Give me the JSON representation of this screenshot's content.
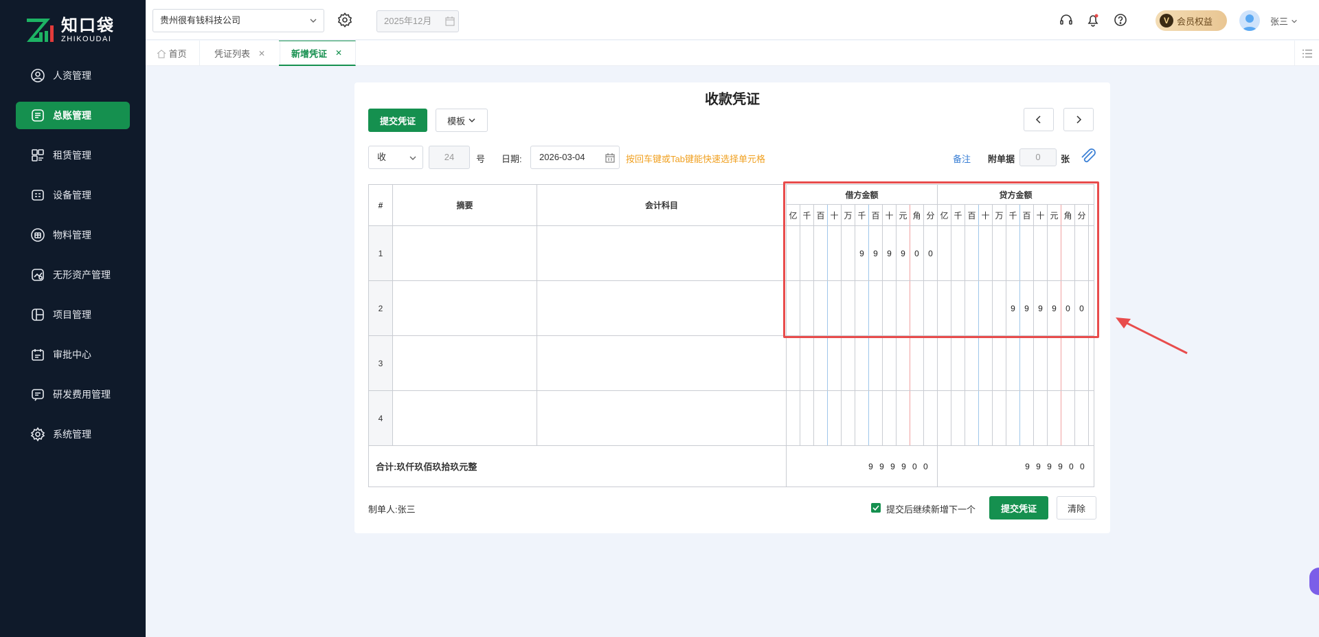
{
  "logo": {
    "cn": "知口袋",
    "en": "ZHIKOUDAI"
  },
  "sidebar": {
    "items": [
      {
        "label": "人资管理",
        "icon": "user-circle-icon"
      },
      {
        "label": "总账管理",
        "icon": "ledger-icon",
        "active": true
      },
      {
        "label": "租赁管理",
        "icon": "lease-icon"
      },
      {
        "label": "设备管理",
        "icon": "device-icon"
      },
      {
        "label": "物料管理",
        "icon": "material-icon"
      },
      {
        "label": "无形资产管理",
        "icon": "asset-icon"
      },
      {
        "label": "项目管理",
        "icon": "project-icon"
      },
      {
        "label": "审批中心",
        "icon": "approval-icon"
      },
      {
        "label": "研发费用管理",
        "icon": "rd-icon"
      },
      {
        "label": "系统管理",
        "icon": "settings-icon"
      }
    ]
  },
  "header": {
    "company": "贵州很有钱科技公司",
    "period": "2025年12月",
    "vip": "会员权益",
    "vip_badge": "V",
    "user": "张三"
  },
  "tabs": [
    {
      "label": "首页"
    },
    {
      "label": "凭证列表"
    },
    {
      "label": "新增凭证"
    }
  ],
  "voucher": {
    "title": "收款凭证",
    "submit": "提交凭证",
    "template": "模板",
    "type": "收",
    "number": "24",
    "number_suffix": "号",
    "date_label": "日期:",
    "date": "2026-03-04",
    "hint": "按回车键或Tab键能快速选择单元格",
    "remark": "备注",
    "attach_label": "附单据",
    "attach_count": "0",
    "attach_unit": "张",
    "headers": {
      "index": "#",
      "summary": "摘要",
      "subject": "会计科目",
      "debit": "借方金额",
      "credit": "贷方金额"
    },
    "digit_units": [
      "亿",
      "千",
      "百",
      "十",
      "万",
      "千",
      "百",
      "十",
      "元",
      "角",
      "分"
    ],
    "rows": [
      {
        "no": "1",
        "debit": "999900",
        "credit": ""
      },
      {
        "no": "2",
        "debit": "",
        "credit": "999900"
      },
      {
        "no": "3",
        "debit": "",
        "credit": ""
      },
      {
        "no": "4",
        "debit": "",
        "credit": ""
      }
    ],
    "total_label": "合计:玖仟玖佰玖拾玖元整",
    "total_debit": "999900",
    "total_credit": "999900",
    "maker": "制单人:张三",
    "continue_label": "提交后继续新增下一个",
    "submit2": "提交凭证",
    "clear": "清除"
  },
  "colors": {
    "brand": "#15904f",
    "highlight": "#e84c4c",
    "hint": "#f0a020",
    "link": "#3a7fd5"
  }
}
